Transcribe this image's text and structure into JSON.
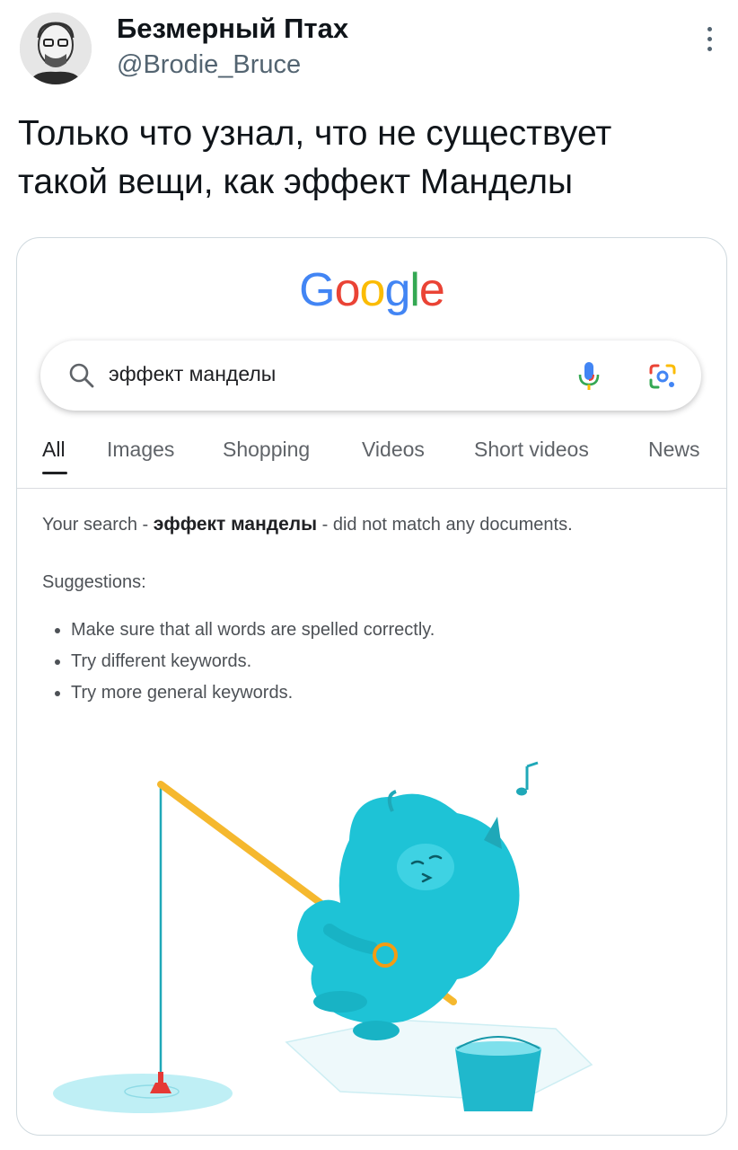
{
  "tweet": {
    "display_name": "Безмерный Птах",
    "handle": "@Brodie_Bruce",
    "text_line1": "Только что узнал, что не существует",
    "text_line2": "такой вещи, как эффект Манделы"
  },
  "google": {
    "logo_letters": [
      "G",
      "o",
      "o",
      "g",
      "l",
      "e"
    ],
    "logo_colors": [
      "#4285F4",
      "#EA4335",
      "#FBBC05",
      "#4285F4",
      "#34A853",
      "#EA4335"
    ],
    "search_query": "эффект манделы",
    "tabs": [
      "All",
      "Images",
      "Shopping",
      "Videos",
      "Short videos",
      "News"
    ],
    "active_tab": "All",
    "result": {
      "prefix": "Your search - ",
      "query": "эффект манделы",
      "suffix": " - did not match any documents.",
      "suggestions_title": "Suggestions:",
      "suggestions": [
        "Make sure that all words are spelled correctly.",
        "Try different keywords.",
        "Try more general keywords."
      ]
    }
  },
  "colors": {
    "accent_blue": "#4285F4",
    "creature": "#1EC3D6",
    "rod": "#F5B82E",
    "bobber": "#E53935"
  }
}
